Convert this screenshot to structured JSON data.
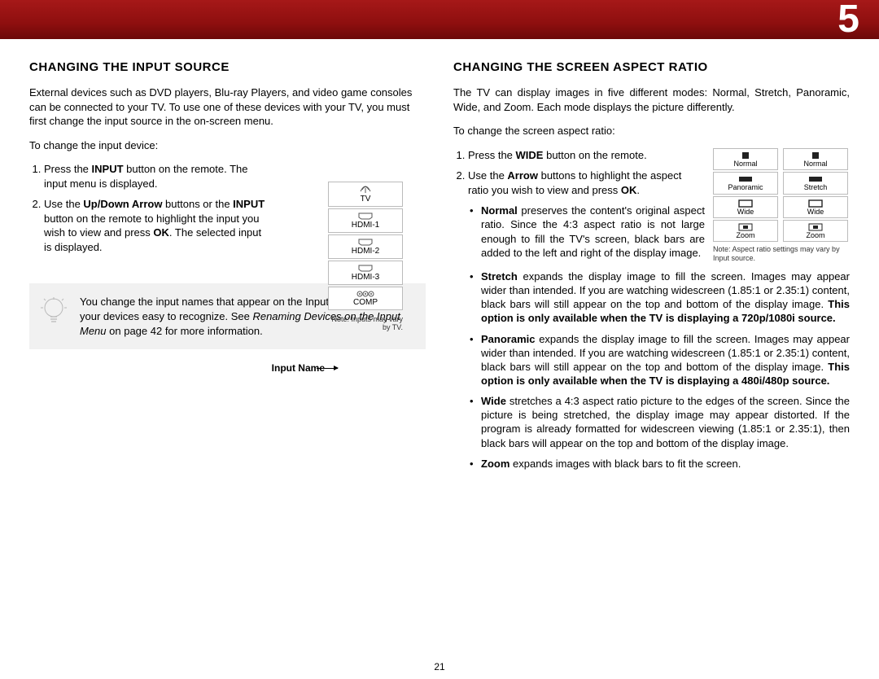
{
  "chapter": "5",
  "page_number": "21",
  "left": {
    "heading": "CHANGING THE INPUT SOURCE",
    "intro": "External devices such as DVD players, Blu-ray Players, and video game consoles can be connected to your TV. To use one of these devices with your TV, you must first change the input source in the on-screen menu.",
    "lead": "To change the input device:",
    "step1_a": "Press the ",
    "step1_b": "INPUT",
    "step1_c": " button on the remote. The input menu is displayed.",
    "step2_a": "Use the ",
    "step2_b": "Up/Down Arrow",
    "step2_c": " buttons or the ",
    "step2_d": "INPUT",
    "step2_e": " button on the remote to highlight the input you wish to view and press ",
    "step2_f": "OK",
    "step2_g": ". The selected input is displayed.",
    "input_name_label": "Input Name",
    "input_note": "Note: Inputs may vary by TV.",
    "menu_items": [
      "TV",
      "HDMI-1",
      "HDMI-2",
      "HDMI-3",
      "COMP"
    ],
    "tip_a": "You change the input names that appear on the Input menu to make your devices easy to recognize. See ",
    "tip_italic": "Renaming Devices on the Input Menu",
    "tip_b": " on page 42 for more information."
  },
  "right": {
    "heading": "CHANGING THE SCREEN ASPECT RATIO",
    "intro": "The TV can display images in five different modes: Normal, Stretch, Panoramic, Wide, and Zoom. Each mode displays the picture differently.",
    "lead": "To change the screen aspect ratio:",
    "step1_a": "Press the ",
    "step1_b": "WIDE",
    "step1_c": " button on the remote.",
    "step2_a": "Use the ",
    "step2_b": "Arrow",
    "step2_c": " buttons to highlight the aspect ratio you wish to view and press ",
    "step2_d": "OK",
    "step2_e": ".",
    "aspect_cols": [
      [
        "Normal",
        "Panoramic",
        "Wide",
        "Zoom"
      ],
      [
        "Normal",
        "Stretch",
        "Wide",
        "Zoom"
      ]
    ],
    "aspect_note": "Note: Aspect ratio settings may vary by Input source.",
    "bullet_normal_a": "Normal",
    "bullet_normal_b": " preserves the content's original aspect ratio. Since the 4:3 aspect ratio is not large enough to fill the TV's screen, black bars are added to the left and right of the display image.",
    "bullet_stretch_a": "Stretch",
    "bullet_stretch_b": " expands the display image to fill the screen. Images may appear wider than intended. If you are watching widescreen (1.85:1 or 2.35:1) content, black bars will still appear on the top and bottom of the display image. ",
    "bullet_stretch_c": "This option is only available when the TV is displaying a 720p/1080i source.",
    "bullet_pano_a": "Panoramic",
    "bullet_pano_b": " expands the display image to fill the screen. Images may appear wider than intended. If you are watching widescreen (1.85:1 or 2.35:1) content, black bars will still appear on the top and bottom of the display image. ",
    "bullet_pano_c": "This option is only available when the TV is displaying a 480i/480p source.",
    "bullet_wide_a": "Wide",
    "bullet_wide_b": " stretches a 4:3 aspect ratio picture to the edges of the screen. Since the picture is being stretched, the display image may appear distorted. If the program is already formatted for widescreen viewing (1.85:1 or 2.35:1), then black bars will appear on the top and bottom of the display image.",
    "bullet_zoom_a": "Zoom",
    "bullet_zoom_b": " expands images with black bars to fit the screen."
  }
}
